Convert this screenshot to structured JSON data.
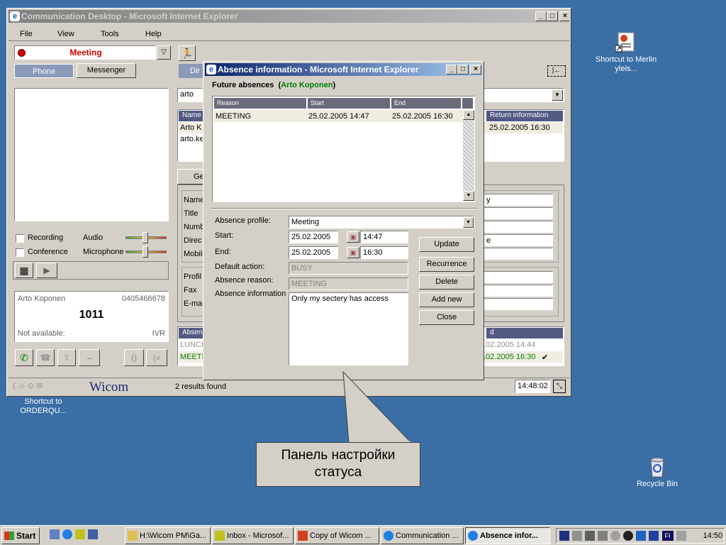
{
  "desktop": {
    "icons": [
      {
        "label": "Shortcut to Merlin yleis..."
      },
      {
        "label": "Recycle Bin"
      },
      {
        "label": "Shortcut to ORDERQU..."
      }
    ]
  },
  "main_window": {
    "title": "Communication Desktop - Microsoft Internet Explorer",
    "menu": [
      "File",
      "View",
      "Tools",
      "Help"
    ],
    "status_select": "Meeting",
    "tabs": [
      "Phone",
      "Messenger"
    ],
    "dir_tab": "Dir",
    "search_value": "arto",
    "checkboxes": [
      "Recording",
      "Conference"
    ],
    "audio_labels": [
      "Audio",
      "Microphone"
    ],
    "caller": {
      "name": "Arto Koponen",
      "number": "0405466678",
      "ext": "1011",
      "status": "Not available:",
      "ivr": "IVR"
    },
    "results_columns": {
      "name": "Name",
      "return": "Return information"
    },
    "results_rows": [
      {
        "name": "Arto K",
        "return": "25.02.2005 16:30"
      },
      {
        "name": "arto.ke",
        "return": ""
      }
    ],
    "general_tab": "Ge",
    "detail_labels": [
      "Name",
      "Title",
      "Numb",
      "Direc",
      "Mobile",
      "Profil",
      "Fax",
      "E-mai"
    ],
    "detail_value_partial": "y",
    "detail_value_partial2": "e",
    "absence_header_left": "Absen",
    "absence_header_right": "d",
    "absence_rows": [
      {
        "left": "LUNCH",
        "right": ".02.2005 14:44"
      },
      {
        "left": "MEETIN",
        "right": ".02.2005 16:30",
        "check": "✔"
      }
    ],
    "logo": "Wicom",
    "results_count": "2 results found",
    "time": "14:48:02"
  },
  "dialog": {
    "title": "Absence information - Microsoft Internet Explorer",
    "heading": "Future absences",
    "person": "Arto Koponen",
    "columns": [
      "Reason",
      "Start",
      "End"
    ],
    "rows": [
      {
        "reason": "MEETING",
        "start": "25.02.2005 14:47",
        "end": "25.02.2005 16:30"
      }
    ],
    "labels": {
      "profile": "Absence profile:",
      "start": "Start:",
      "end": "End:",
      "default_action": "Default action:",
      "reason": "Absence reason:",
      "info": "Absence information"
    },
    "values": {
      "profile": "Meeting",
      "start_date": "25.02.2005",
      "start_time": "14:47",
      "end_date": "25.02.2005",
      "end_time": "16:30",
      "default_action": "BUSY",
      "reason": "MEETING",
      "info": "Only my sectery has access"
    },
    "buttons": [
      "Update",
      "Recurrence",
      "Delete",
      "Add new",
      "Close"
    ]
  },
  "callout": {
    "text_line1": "Панель настройки",
    "text_line2": "статуса"
  },
  "taskbar": {
    "start": "Start",
    "tasks": [
      "H:\\Wicom PM\\Ga...",
      "Inbox - Microsof...",
      "Copy of Wicom ...",
      "Communication ...",
      "Absence infor..."
    ],
    "clock": "14:50",
    "lang": "FI"
  },
  "colors": {
    "desktop": "#3a6ea5",
    "title_active": "#0a246a",
    "status_red": "#cc0000",
    "green_name": "#008000"
  }
}
